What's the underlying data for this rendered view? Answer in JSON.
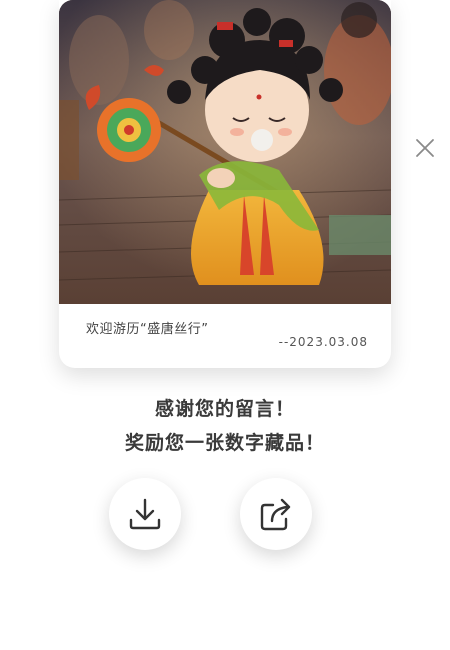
{
  "card": {
    "caption": "欢迎游历“盛唐丝行”",
    "date": "--2023.03.08"
  },
  "message": {
    "line1": "感谢您的留言！",
    "line2": "奖励您一张数字藏品！"
  },
  "actions": {
    "download_icon": "download-icon",
    "share_icon": "share-icon",
    "close_icon": "close-icon"
  },
  "colors": {
    "text_primary": "#3a3a3a",
    "text_secondary": "#555555",
    "card_bg": "#ffffff"
  }
}
